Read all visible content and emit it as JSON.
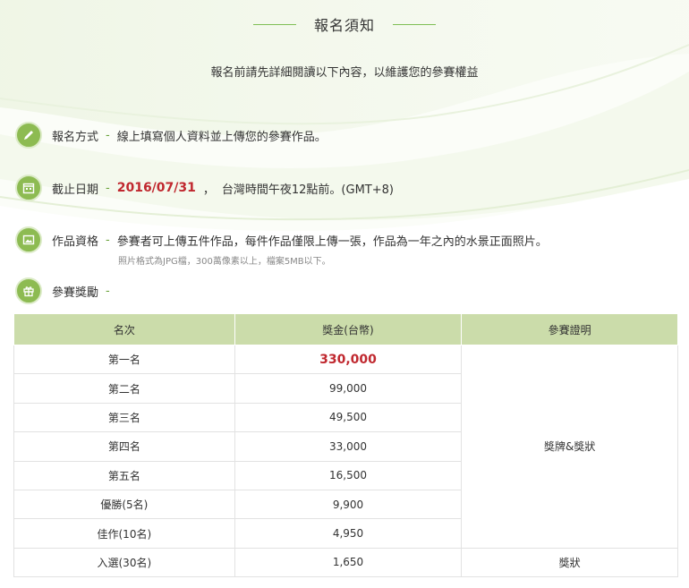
{
  "header": {
    "title": "報名須知"
  },
  "subtitle": "報名前請先詳細閱讀以下內容，以維護您的參賽權益",
  "sections": {
    "method": {
      "label": "報名方式",
      "text": "線上填寫個人資料並上傳您的參賽作品。",
      "icon": "pencil-icon"
    },
    "deadline": {
      "label": "截止日期",
      "date": "2016/07/31",
      "sep": "，",
      "text": "台灣時間午夜12點前。(GMT+8)",
      "icon": "calendar-icon"
    },
    "eligibility": {
      "label": "作品資格",
      "text": "參賽者可上傳五件作品，每件作品僅限上傳一張，作品為一年之內的水景正面照片。",
      "note": "照片格式為JPG檔，300萬像素以上，檔案5MB以下。",
      "icon": "image-icon"
    },
    "prizes": {
      "label": "參賽獎勵",
      "icon": "gift-icon"
    }
  },
  "dash": "-",
  "table": {
    "headers": [
      "名次",
      "獎金(台幣)",
      "參賽證明"
    ],
    "rows": [
      {
        "rank": "第一名",
        "prize": "330,000"
      },
      {
        "rank": "第二名",
        "prize": "99,000"
      },
      {
        "rank": "第三名",
        "prize": "49,500"
      },
      {
        "rank": "第四名",
        "prize": "33,000"
      },
      {
        "rank": "第五名",
        "prize": "16,500"
      },
      {
        "rank": "優勝(5名)",
        "prize": "9,900"
      },
      {
        "rank": "佳作(10名)",
        "prize": "4,950"
      },
      {
        "rank": "入選(30名)",
        "prize": "1,650"
      }
    ],
    "cert_group": "獎牌&獎狀",
    "cert_last": "獎狀"
  },
  "colors": {
    "accent": "#8dbb52",
    "highlight": "#c0282f",
    "table_header": "#cbdcaa"
  }
}
